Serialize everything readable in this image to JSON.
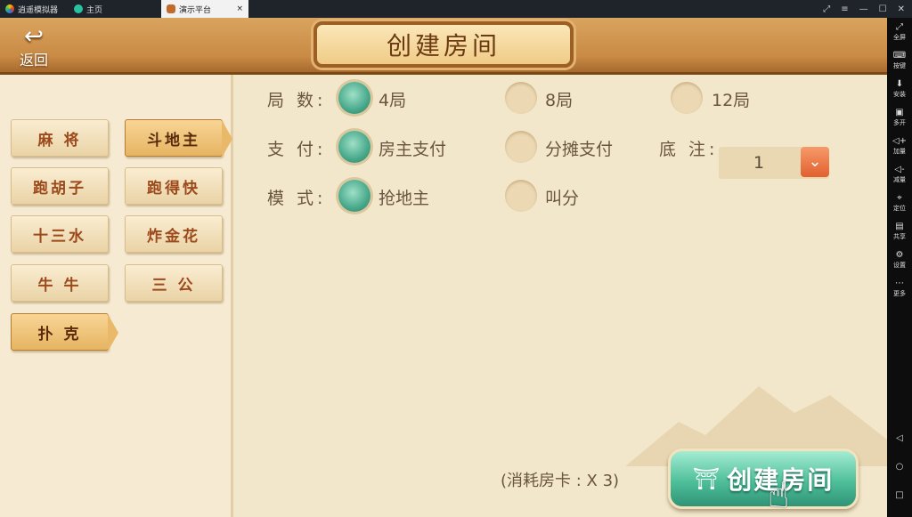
{
  "emulator": {
    "tabs": [
      {
        "label": "逍遥模拟器"
      },
      {
        "label": "主页"
      },
      {
        "label": "演示平台",
        "close": "×"
      }
    ],
    "window_controls": [
      "⤢",
      "≡",
      "—",
      "☐",
      "✕"
    ],
    "sidebar": [
      {
        "icon": "⤢",
        "label": "全屏"
      },
      {
        "icon": "⌨",
        "label": "按键"
      },
      {
        "icon": "⬇",
        "label": "安装"
      },
      {
        "icon": "▣",
        "label": "多开"
      },
      {
        "icon": "◁+",
        "label": "加量"
      },
      {
        "icon": "◁-",
        "label": "减量"
      },
      {
        "icon": "⌖",
        "label": "定位"
      },
      {
        "icon": "▤",
        "label": "共享"
      },
      {
        "icon": "⚙",
        "label": "设置"
      },
      {
        "icon": "⋯",
        "label": "更多"
      }
    ],
    "nav": [
      "◁",
      "○",
      "□"
    ]
  },
  "header": {
    "back_label": "返回",
    "back_icon": "↩",
    "title": "创建房间"
  },
  "categories": [
    {
      "label": "麻 将",
      "selected": false
    },
    {
      "label": "跑胡子",
      "selected": false
    },
    {
      "label": "十三水",
      "selected": false
    },
    {
      "label": "牛 牛",
      "selected": false
    },
    {
      "label": "扑 克",
      "selected": true
    }
  ],
  "games": [
    {
      "label": "斗地主",
      "selected": true
    },
    {
      "label": "跑得快",
      "selected": false
    },
    {
      "label": "炸金花",
      "selected": false
    },
    {
      "label": "三 公",
      "selected": false
    }
  ],
  "options": {
    "rounds": {
      "label": "局 数:",
      "choices": [
        {
          "text": "4局",
          "on": true
        },
        {
          "text": "8局",
          "on": false
        },
        {
          "text": "12局",
          "on": false
        }
      ]
    },
    "pay": {
      "label": "支 付:",
      "choices": [
        {
          "text": "房主支付",
          "on": true
        },
        {
          "text": "分摊支付",
          "on": false
        }
      ]
    },
    "bet": {
      "label": "底 注:",
      "value": "1",
      "dropdown_icon": "⌄"
    },
    "mode": {
      "label": "模 式:",
      "choices": [
        {
          "text": "抢地主",
          "on": true
        },
        {
          "text": "叫分",
          "on": false
        }
      ]
    }
  },
  "cost_text": "(消耗房卡 : X 3)",
  "create_button": {
    "label": "创建房间",
    "icon": "⛩"
  },
  "colors": {
    "accent": "#4fbf9a",
    "panel": "#f3e7cb",
    "header": "#c98b45"
  }
}
